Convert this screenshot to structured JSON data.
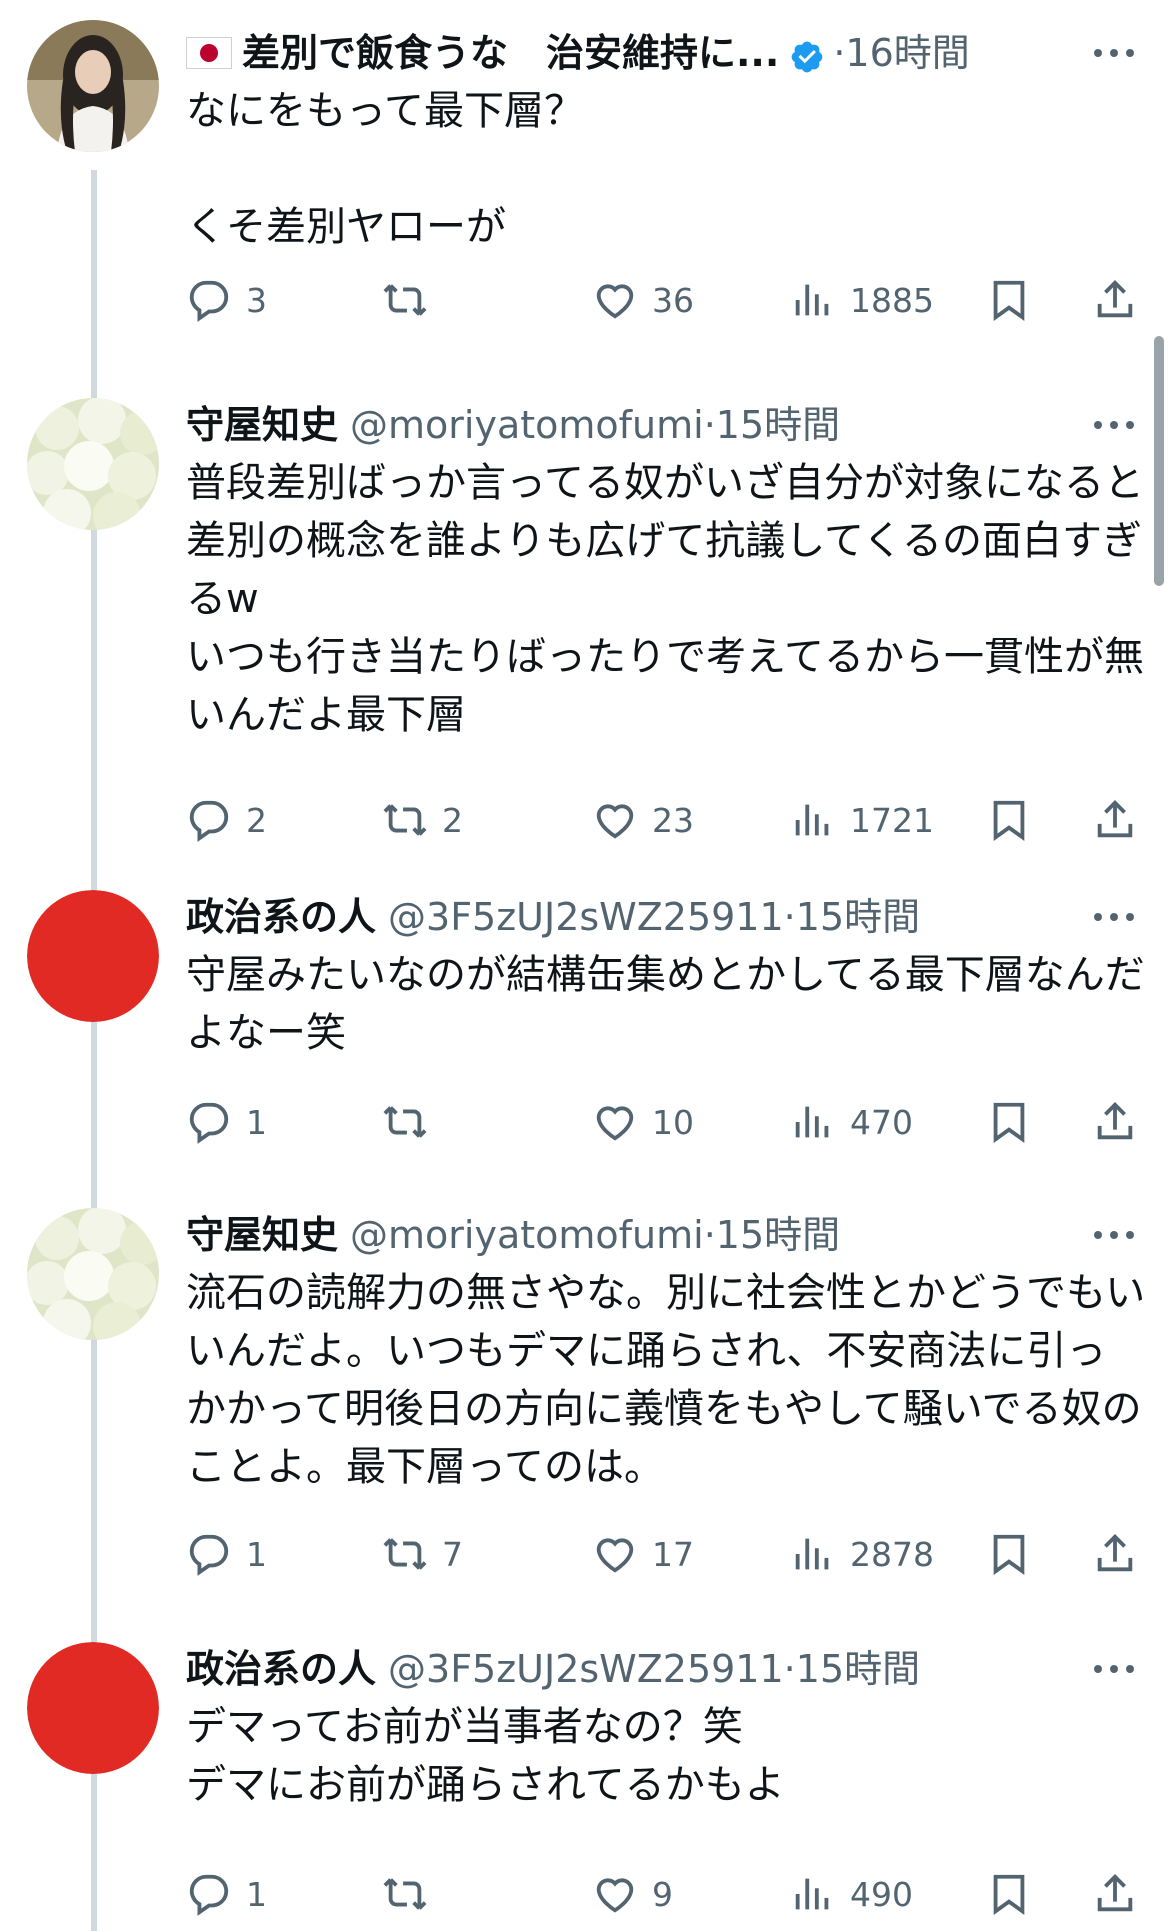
{
  "tweets": [
    {
      "display_name": "差別で飯食うな　治安維持に...",
      "has_flag": true,
      "verified": true,
      "handle": "",
      "time": "16時間",
      "text": "なにをもって最下層？\n\nくそ差別ヤローが",
      "replies": "3",
      "retweets": "",
      "likes": "36",
      "views": "1885"
    },
    {
      "display_name": "守屋知史",
      "handle": "@moriyatomofumi",
      "time": "15時間",
      "text": "普段差別ばっか言ってる奴がいざ自分が対象になると差別の概念を誰よりも広げて抗議してくるの面白すぎるw\nいつも行き当たりばったりで考えてるから一貫性が無いんだよ最下層",
      "replies": "2",
      "retweets": "2",
      "likes": "23",
      "views": "1721"
    },
    {
      "display_name": "政治系の人",
      "handle": "@3F5zUJ2sWZ25911",
      "time": "15時間",
      "text": "守屋みたいなのが結構缶集めとかしてる最下層なんだよなー笑",
      "replies": "1",
      "retweets": "",
      "likes": "10",
      "views": "470"
    },
    {
      "display_name": "守屋知史",
      "handle": "@moriyatomofumi",
      "time": "15時間",
      "text": "流石の読解力の無さやな。別に社会性とかどうでもいいんだよ。いつもデマに踊らされ、不安商法に引っかかって明後日の方向に義憤をもやして騒いでる奴のことよ。最下層ってのは。",
      "replies": "1",
      "retweets": "7",
      "likes": "17",
      "views": "2878"
    },
    {
      "display_name": "政治系の人",
      "handle": "@3F5zUJ2sWZ25911",
      "time": "15時間",
      "text": "デマってお前が当事者なの？笑\nデマにお前が踊らされてるかもよ",
      "replies": "1",
      "retweets": "",
      "likes": "9",
      "views": "490"
    }
  ],
  "separator": "·",
  "icons": [
    "reply-icon",
    "retweet-icon",
    "like-icon",
    "views-icon",
    "bookmark-icon",
    "share-icon",
    "more-icon",
    "verified-badge-icon"
  ],
  "colors": {
    "text": "#0f1419",
    "secondary": "#536471",
    "verified": "#1d9bf0",
    "thread_line": "#cfd9de",
    "avatar_red": "#e12a24"
  }
}
